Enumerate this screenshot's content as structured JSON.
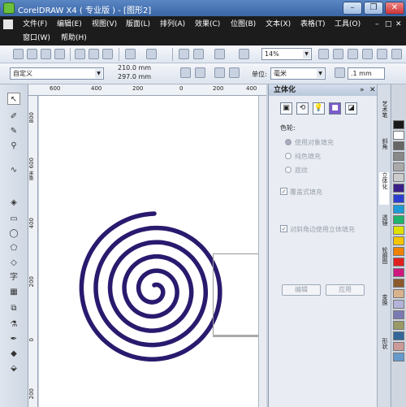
{
  "window": {
    "title": "CorelDRAW X4 ( 专业版 ) - [图形2]",
    "btn_min": "–",
    "btn_max": "❐",
    "btn_close": "✕"
  },
  "menus": [
    "文件(F)",
    "编辑(E)",
    "视图(V)",
    "版面(L)",
    "排列(A)",
    "效果(C)",
    "位图(B)",
    "文本(X)",
    "表格(T)",
    "工具(O)",
    "窗口(W)",
    "帮助(H)"
  ],
  "doc_menu_buttons": [
    "–",
    "□",
    "✕"
  ],
  "toolbar": {
    "zoom": "14%",
    "icons": [
      "new-icon",
      "open-icon",
      "save-icon",
      "print-icon",
      "cut-icon",
      "copy-icon",
      "paste-icon",
      "undo-icon",
      "redo-icon",
      "import-icon",
      "export-icon",
      "app-launcher-icon",
      "welcome-icon"
    ]
  },
  "property_bar": {
    "paper": "自定义",
    "width": "210.0 mm",
    "height": "297.0 mm",
    "units_label": "单位:",
    "units": "毫米",
    "nudge": ".1 mm"
  },
  "rulers": {
    "h": [
      "600",
      "400",
      "200",
      "0",
      "200",
      "400"
    ],
    "v": [
      "800",
      "600",
      "400",
      "200",
      "0",
      "200"
    ],
    "v_unit": "毫米"
  },
  "docker": {
    "title": "立体化",
    "section": "色轮:",
    "radios": [
      "使用对象填充",
      "纯色填充",
      "底纹"
    ],
    "overprint": "覆盖式填充",
    "bevel": "对斜角边使用立体填充",
    "edit_btn": "编辑",
    "apply_btn": "应用"
  },
  "side_tabs": [
    "艺术笔",
    "斜角",
    "立体化",
    "透镜",
    "轮廓图",
    "变换",
    "形状"
  ],
  "palette_colors": [
    "#1a1a1a",
    "#ffffff",
    "#666666",
    "#888888",
    "#aaaaaa",
    "#cccccc",
    "#3b1f88",
    "#2a3fd1",
    "#1d9bd7",
    "#1fb46b",
    "#e0e000",
    "#f5c400",
    "#f08200",
    "#e01f1f",
    "#d0177e",
    "#8c5a2b",
    "#d9b38c",
    "#b3b3d9",
    "#7a7ab3",
    "#999966",
    "#336699",
    "#cc9999",
    "#6699cc"
  ],
  "colors": {
    "spiral": "#2a1a6e"
  }
}
